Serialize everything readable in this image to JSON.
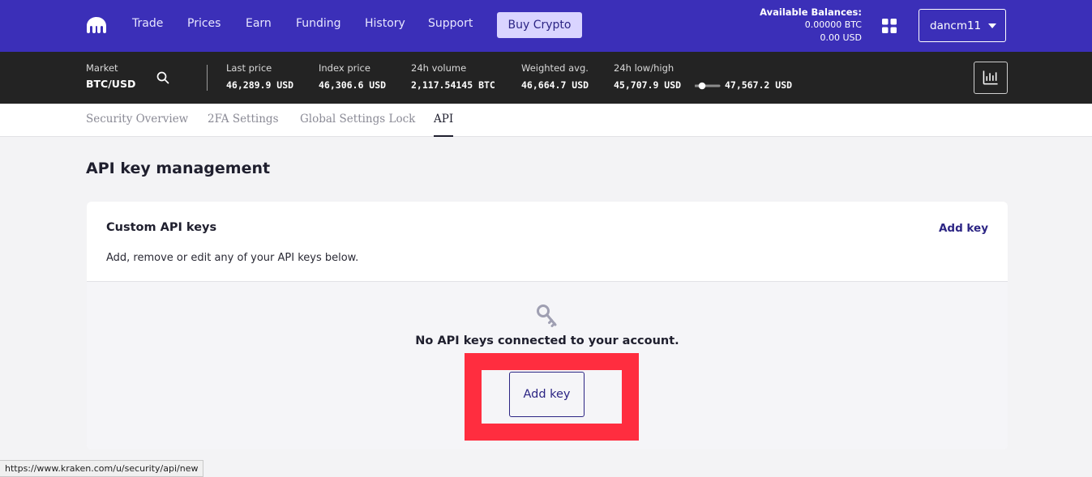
{
  "nav": {
    "items": [
      "Trade",
      "Prices",
      "Earn",
      "Funding",
      "History",
      "Support"
    ],
    "buy_label": "Buy Crypto",
    "balances": {
      "title": "Available Balances:",
      "btc": "0.00000 BTC",
      "usd": "0.00 USD"
    },
    "username": "dancm11"
  },
  "ticker": {
    "market_label": "Market",
    "market_value": "BTC/USD",
    "last_price": {
      "label": "Last price",
      "value": "46,289.9 USD"
    },
    "index_price": {
      "label": "Index price",
      "value": "46,306.6 USD"
    },
    "volume": {
      "label": "24h volume",
      "value": "2,117.54145 BTC"
    },
    "weighted": {
      "label": "Weighted avg.",
      "value": "46,664.7 USD"
    },
    "lowhigh": {
      "label": "24h low/high",
      "low": "45,707.9 USD",
      "high": "47,567.2 USD"
    }
  },
  "subtabs": [
    "Security Overview",
    "2FA Settings",
    "Global Settings Lock",
    "API"
  ],
  "main": {
    "title": "API key management",
    "card_title": "Custom API keys",
    "card_add_link": "Add key",
    "card_desc": "Add, remove or edit any of your API keys below.",
    "empty_message": "No API keys connected to your account.",
    "add_key_button": "Add key"
  },
  "statusbar": {
    "url": "https://www.kraken.com/u/security/api/new"
  },
  "colors": {
    "nav_bg": "#3b2fb8",
    "ticker_bg": "#232323",
    "accent": "#2c2584",
    "highlight": "#ff2d3f"
  },
  "icons": [
    "kraken-logo-icon",
    "apps-grid-icon",
    "search-icon",
    "chart-icon",
    "key-icon"
  ]
}
